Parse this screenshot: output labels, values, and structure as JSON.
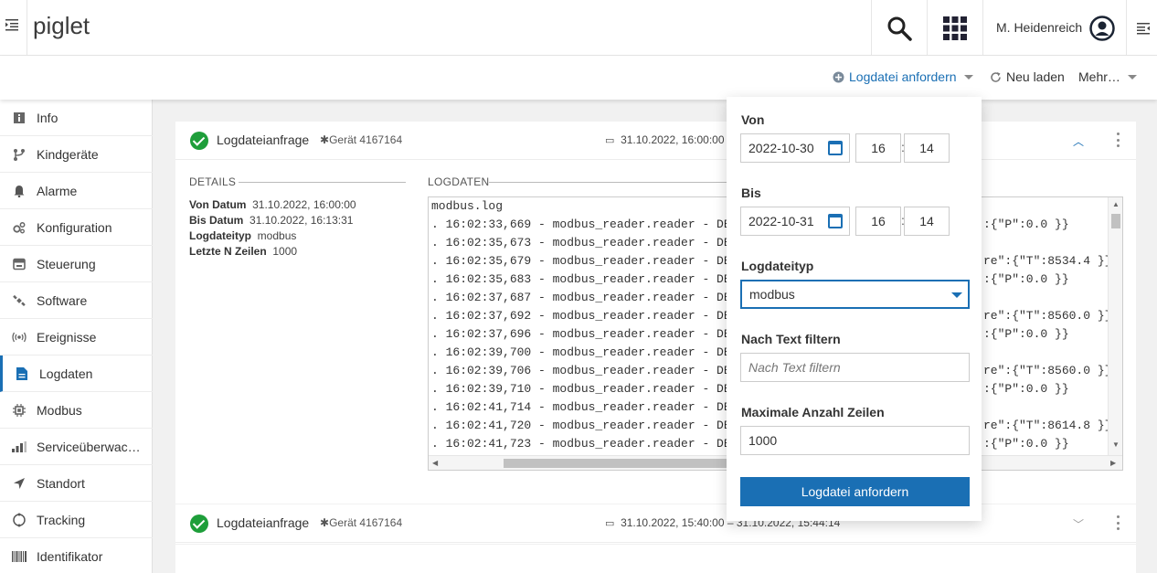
{
  "header": {
    "app_name": "piglet",
    "user_name": "M. Heidenreich"
  },
  "actions": {
    "request_log": "Logdatei anfordern",
    "reload": "Neu laden",
    "more": "Mehr…"
  },
  "sidebar": {
    "items": [
      {
        "label": "Info",
        "icon": "info-icon"
      },
      {
        "label": "Kindgeräte",
        "icon": "branch-icon"
      },
      {
        "label": "Alarme",
        "icon": "bell-icon"
      },
      {
        "label": "Konfiguration",
        "icon": "cogs-icon"
      },
      {
        "label": "Steuerung",
        "icon": "control-icon"
      },
      {
        "label": "Software",
        "icon": "satellite-icon"
      },
      {
        "label": "Ereignisse",
        "icon": "broadcast-icon"
      },
      {
        "label": "Logdaten",
        "icon": "file-icon",
        "active": true
      },
      {
        "label": "Modbus",
        "icon": "chip-icon"
      },
      {
        "label": "Serviceüberwac…",
        "icon": "bars-icon"
      },
      {
        "label": "Standort",
        "icon": "location-arrow-icon"
      },
      {
        "label": "Tracking",
        "icon": "circle-icon"
      },
      {
        "label": "Identifikator",
        "icon": "barcode-icon"
      }
    ]
  },
  "cards": [
    {
      "title": "Logdateianfrage",
      "device": "Gerät 4167164",
      "date": "31.10.2022, 16:00:00"
    },
    {
      "title": "Logdateianfrage",
      "device": "Gerät 4167164",
      "date": "31.10.2022, 15:40:00 – 31.10.2022, 15:44:14"
    }
  ],
  "details": {
    "section_label": "DETAILS",
    "rows": [
      {
        "key": "Von Datum",
        "value": "31.10.2022, 16:00:00"
      },
      {
        "key": "Bis Datum",
        "value": "31.10.2022, 16:13:31"
      },
      {
        "key": "Logdateityp",
        "value": "modbus"
      },
      {
        "key": "Letzte N Zeilen",
        "value": "1000"
      }
    ]
  },
  "logdata": {
    "section_label": "LOGDATEN",
    "filename": "modbus.log",
    "lines": [
      ". 16:02:33,669 - modbus_reader.reader - DEB",
      ". 16:02:35,673 - modbus_reader.reader - DEB",
      ". 16:02:35,679 - modbus_reader.reader - DEB",
      ". 16:02:35,683 - modbus_reader.reader - DEB",
      ". 16:02:37,687 - modbus_reader.reader - DEB",
      ". 16:02:37,692 - modbus_reader.reader - DEB",
      ". 16:02:37,696 - modbus_reader.reader - DEB",
      ". 16:02:39,700 - modbus_reader.reader - DEB",
      ". 16:02:39,706 - modbus_reader.reader - DEB",
      ". 16:02:39,710 - modbus_reader.reader - DEB",
      ". 16:02:41,714 - modbus_reader.reader - DEB",
      ". 16:02:41,720 - modbus_reader.reader - DEB",
      ". 16:02:41,723 - modbus_reader.reader - DEB"
    ],
    "tails": [
      ":{\"P\":0.0 }}",
      "",
      "re\":{\"T\":8534.4 }}",
      ":{\"P\":0.0 }}",
      "",
      "re\":{\"T\":8560.0 }}",
      ":{\"P\":0.0 }}",
      "",
      "re\":{\"T\":8560.0 }}",
      ":{\"P\":0.0 }}",
      "",
      "re\":{\"T\":8614.8 }}",
      ":{\"P\":0.0 }}"
    ]
  },
  "panel": {
    "von_label": "Von",
    "von_date": "2022-10-30",
    "von_hour": "16",
    "von_min": "14",
    "bis_label": "Bis",
    "bis_date": "2022-10-31",
    "bis_hour": "16",
    "bis_min": "14",
    "type_label": "Logdateityp",
    "type_value": "modbus",
    "filter_label": "Nach Text filtern",
    "filter_placeholder": "Nach Text filtern",
    "maxlines_label": "Maximale Anzahl Zeilen",
    "maxlines_value": "1000",
    "submit_label": "Logdatei anfordern"
  },
  "colors": {
    "accent": "#1a6fb4",
    "success": "#1e9e3a"
  }
}
